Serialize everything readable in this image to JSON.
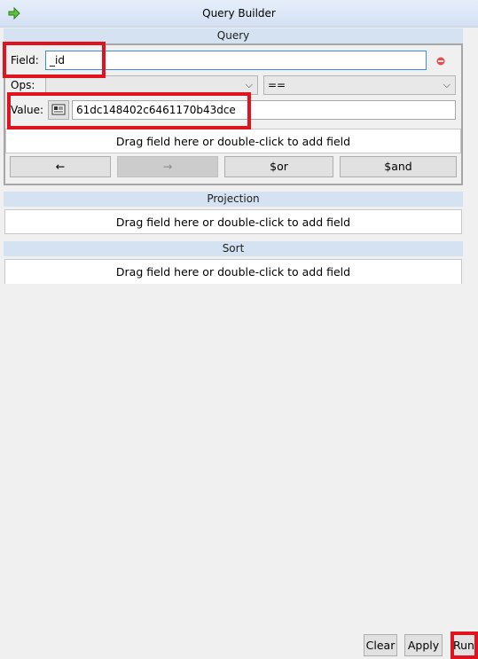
{
  "window": {
    "title": "Query Builder"
  },
  "query": {
    "section_title": "Query",
    "field_label": "Field:",
    "field_value": "_id",
    "ops_label": "Ops:",
    "ops_field_value": "",
    "ops_operator_value": "==",
    "value_label": "Value:",
    "value_value": "61dc148402c6461170b43dce",
    "dropzone_text": "Drag field here or double-click to add field",
    "buttons": {
      "left_arrow": "←",
      "right_arrow": "→",
      "or": "$or",
      "and": "$and"
    }
  },
  "projection": {
    "section_title": "Projection",
    "dropzone_text": "Drag field here or double-click to add field"
  },
  "sort": {
    "section_title": "Sort",
    "dropzone_text": "Drag field here or double-click to add field"
  },
  "footer": {
    "clear_label": "Clear",
    "apply_label": "Apply",
    "run_label": "Run"
  },
  "colors": {
    "highlight": "#e0141e",
    "header_bg": "#d5e2f1",
    "focus_border": "#3c8fd4"
  }
}
